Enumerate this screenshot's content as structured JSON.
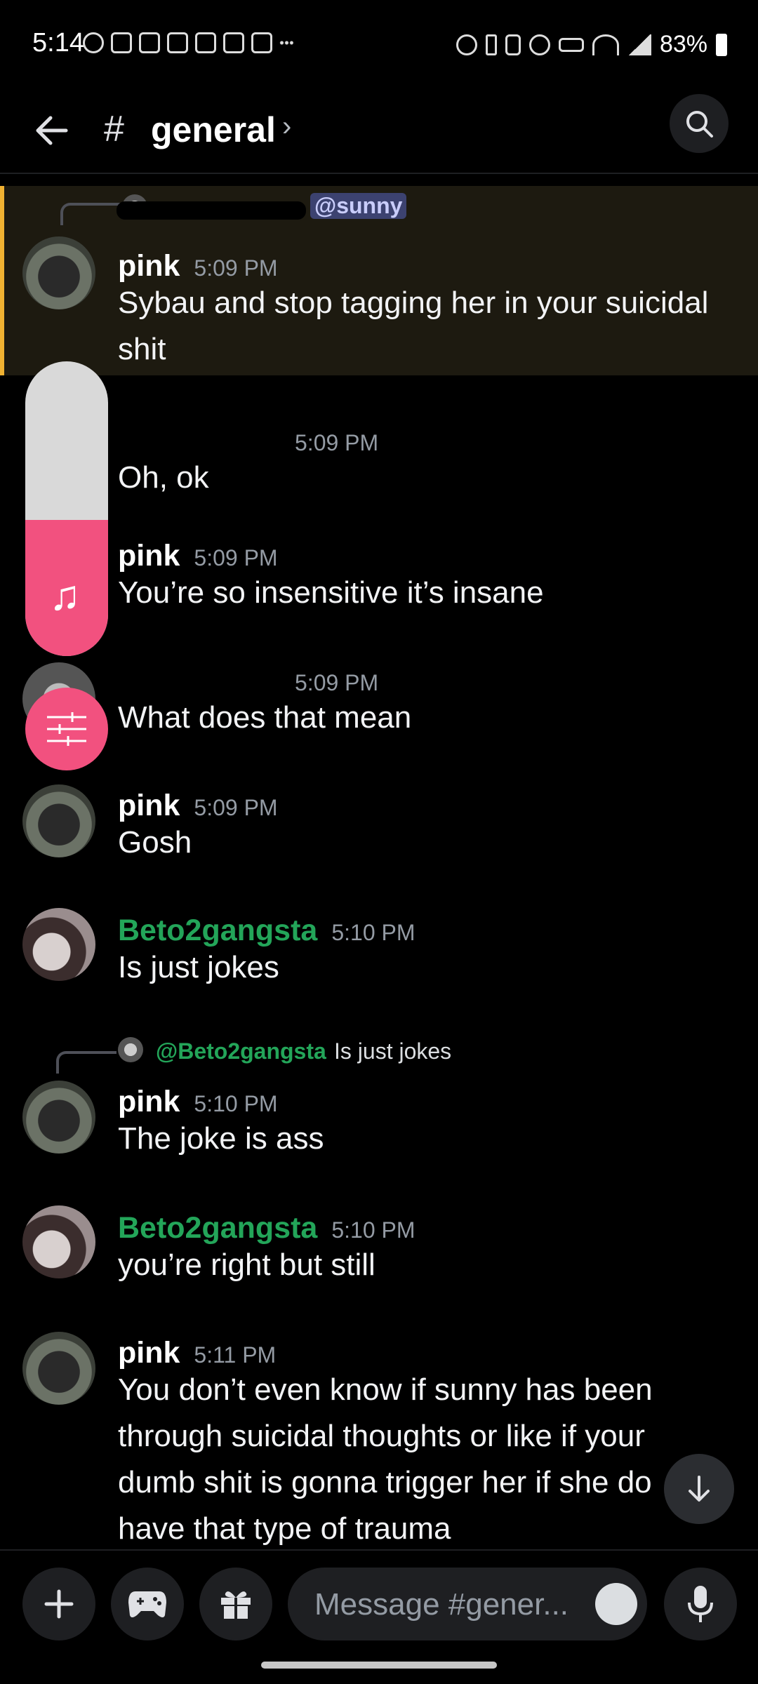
{
  "status_bar": {
    "time": "5:14",
    "battery": "83%"
  },
  "header": {
    "channel_hash": "#",
    "channel_name": "general",
    "chevron": "›"
  },
  "messages": [
    {
      "author": "pink",
      "time": "5:09 PM",
      "text": "Sybau and stop tagging her in your suicidal shit",
      "reply_mention": "@sunny",
      "highlighted": true
    },
    {
      "author": "",
      "time": "5:09 PM",
      "text": "Oh, ok"
    },
    {
      "author": "pink",
      "time": "5:09 PM",
      "text": "You’re so insensitive it’s insane"
    },
    {
      "author": "",
      "time": "5:09 PM",
      "text": "What does that mean"
    },
    {
      "author": "pink",
      "time": "5:09 PM",
      "text": "Gosh"
    },
    {
      "author": "Beto2gangsta",
      "time": "5:10 PM",
      "text": "Is just jokes"
    },
    {
      "author": "pink",
      "time": "5:10 PM",
      "text": "The joke is ass",
      "reply_mention": "@Beto2gangsta",
      "reply_text": "Is just jokes"
    },
    {
      "author": "Beto2gangsta",
      "time": "5:10 PM",
      "text": "you’re right but still"
    },
    {
      "author": "pink",
      "time": "5:11 PM",
      "text": "You don’t even know if sunny has been through suicidal thoughts or like if your dumb shit is gonna trigger her if she do have that type of trauma"
    }
  ],
  "composer": {
    "placeholder": "Message #gener..."
  },
  "colors": {
    "accent_pink": "#f2517f",
    "username_green": "#23a559",
    "mention_bg": "#3c4270"
  },
  "icons": [
    "back-arrow-icon",
    "hash-icon",
    "search-icon",
    "music-note-icon",
    "sliders-icon",
    "arrow-down-icon",
    "plus-icon",
    "gamepad-icon",
    "gift-icon",
    "emoji-icon",
    "microphone-icon"
  ]
}
